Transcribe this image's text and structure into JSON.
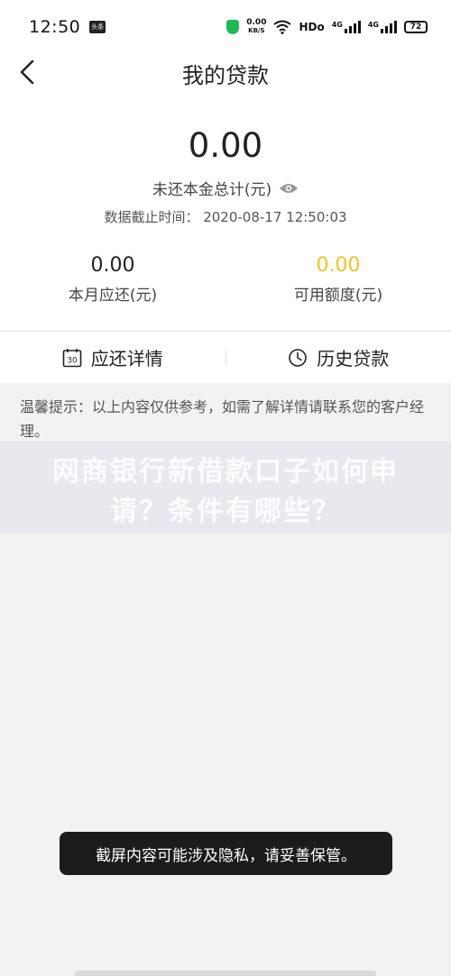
{
  "status_bar": {
    "time": "12:50",
    "app_badge": "头条",
    "net_speed_value": "0.00",
    "net_speed_unit": "KB/S",
    "hd_label": "HDo",
    "sig1_label": "4G",
    "sig2_label": "4G",
    "battery": "72"
  },
  "header": {
    "title": "我的贷款",
    "total_amount": "0.00",
    "total_label": "未还本金总计(元)",
    "data_time": "数据截止时间： 2020-08-17 12:50:03",
    "monthly_value": "0.00",
    "monthly_label": "本月应还(元)",
    "available_value": "0.00",
    "available_label": "可用额度(元)"
  },
  "tabs": {
    "repay_detail": "应还详情",
    "repay_icon_number": "30",
    "history": "历史贷款"
  },
  "notice": "温馨提示：以上内容仅供参考，如需了解详情请联系您的客户经理。",
  "watermark": "网商银行新借款口子如何申请？条件有哪些？",
  "toast": "截屏内容可能涉及隐私，请妥善保管。",
  "colors": {
    "accent_yellow": "#f7c21b",
    "background": "#f2f2f2",
    "card": "#ffffff",
    "toast_bg": "#1c1c1c"
  }
}
